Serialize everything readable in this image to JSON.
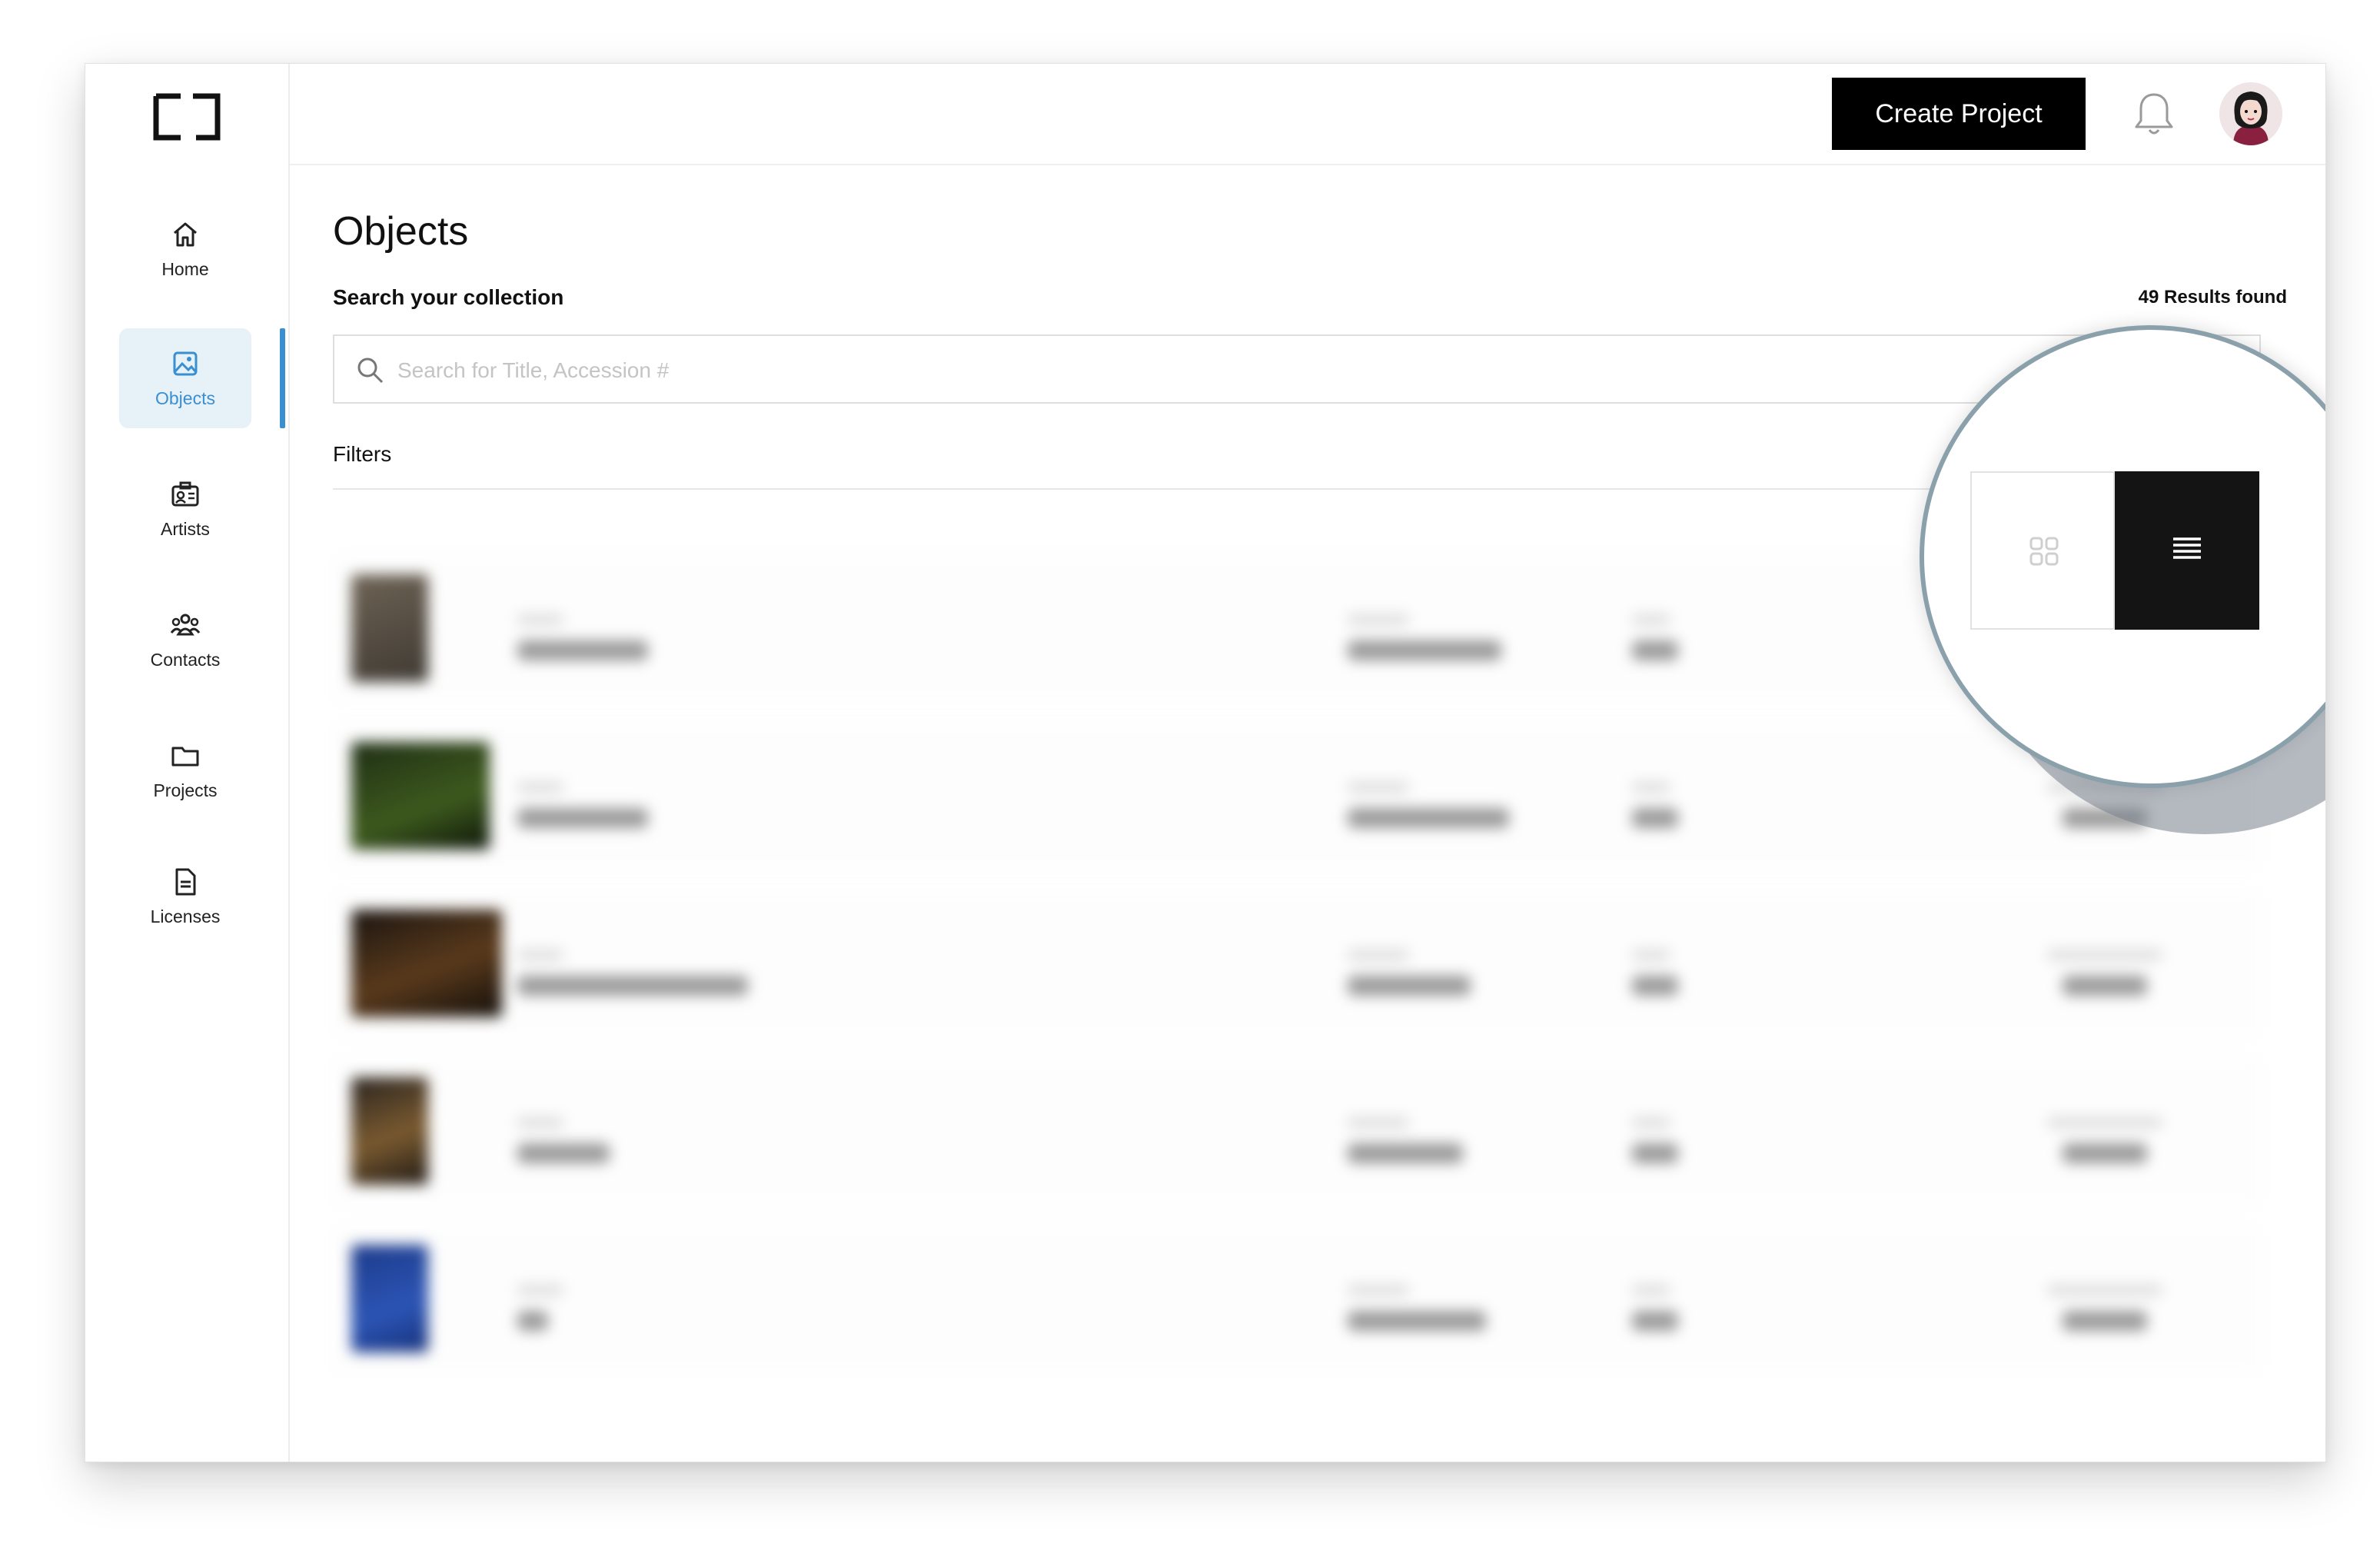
{
  "sidebar": {
    "items": [
      {
        "label": "Home",
        "icon": "home-icon",
        "active": false
      },
      {
        "label": "Objects",
        "icon": "image-icon",
        "active": true
      },
      {
        "label": "Artists",
        "icon": "id-card-icon",
        "active": false
      },
      {
        "label": "Contacts",
        "icon": "people-icon",
        "active": false
      },
      {
        "label": "Projects",
        "icon": "folder-icon",
        "active": false
      },
      {
        "label": "Licenses",
        "icon": "document-icon",
        "active": false
      }
    ]
  },
  "topbar": {
    "create_button": "Create Project",
    "bell_icon": "bell-icon",
    "avatar_icon": "user-avatar"
  },
  "main": {
    "title": "Objects",
    "search_label": "Search your collection",
    "results_count": "49 Results found",
    "search_placeholder": "Search for Title, Accession #",
    "filters_label": "Filters"
  },
  "view_toggle": {
    "options": [
      "grid-view",
      "list-view"
    ],
    "selected": "list-view"
  },
  "colors": {
    "accent": "#3a8fd0",
    "active_bg": "#e6f1f8",
    "button_bg": "#000000",
    "toggle_active_bg": "#141414"
  }
}
